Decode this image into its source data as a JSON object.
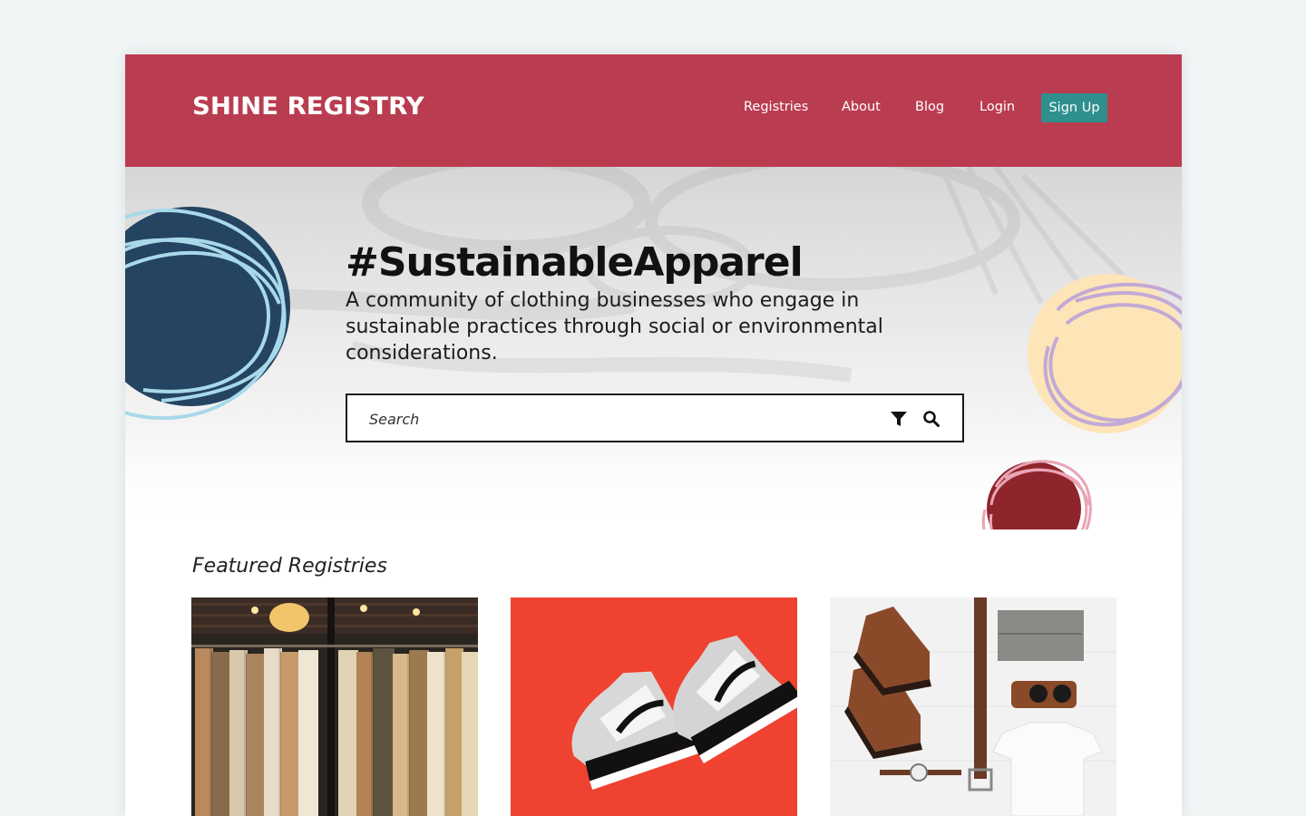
{
  "header": {
    "logo": "SHINE REGISTRY",
    "nav": [
      "Registries",
      "About",
      "Blog",
      "Login"
    ],
    "signup_label": "Sign Up"
  },
  "hero": {
    "title": "#SustainableApparel",
    "subtitle": "A community of clothing businesses who engage in sustainable practices through social or environmental considerations.",
    "search": {
      "placeholder": "Search",
      "filter_icon": "filter-icon",
      "search_icon": "search-icon"
    }
  },
  "featured": {
    "title": "Featured Registries",
    "cards": [
      {
        "image": "clothing-rack-photo"
      },
      {
        "image": "sneakers-on-red-photo"
      },
      {
        "image": "flatlay-boots-outfit-photo"
      }
    ]
  },
  "colors": {
    "header": "#ba3c50",
    "signup": "#2e8f8d",
    "page_bg": "#f1f5f6",
    "navy": "#244461",
    "light_blue": "#a8d9ea",
    "cream": "#fde5b8",
    "lavender": "#c2a9d6",
    "dark_red": "#8f252c",
    "pink": "#eaa4b6"
  }
}
